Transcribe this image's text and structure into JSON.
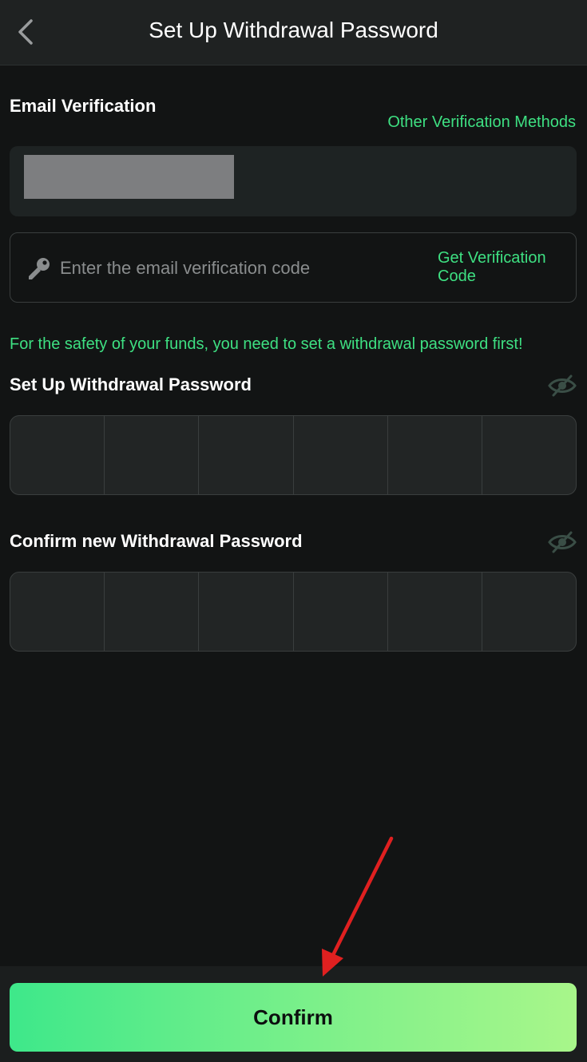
{
  "header": {
    "title": "Set Up Withdrawal Password",
    "back_icon": "chevron-left-icon"
  },
  "email_section": {
    "label": "Email Verification",
    "other_methods_link": "Other Verification Methods",
    "email_value_redacted": true
  },
  "code_field": {
    "placeholder": "Enter the email verification code",
    "value": "",
    "icon": "key-icon",
    "get_code_label": "Get Verification Code"
  },
  "notice": "For the safety of your funds, you need to set a withdrawal password first!",
  "password": {
    "label": "Set Up Withdrawal Password",
    "digits": [
      "",
      "",
      "",
      "",
      "",
      ""
    ],
    "visibility_icon": "eye-off-icon"
  },
  "confirm_password": {
    "label": "Confirm new Withdrawal Password",
    "digits": [
      "",
      "",
      "",
      "",
      "",
      ""
    ],
    "visibility_icon": "eye-off-icon"
  },
  "footer": {
    "confirm_label": "Confirm"
  },
  "colors": {
    "background": "#121414",
    "accent_green": "#3ee082",
    "button_gradient_start": "#3ee88a",
    "button_gradient_end": "#a8f68a",
    "annotation_arrow": "#e02020"
  }
}
